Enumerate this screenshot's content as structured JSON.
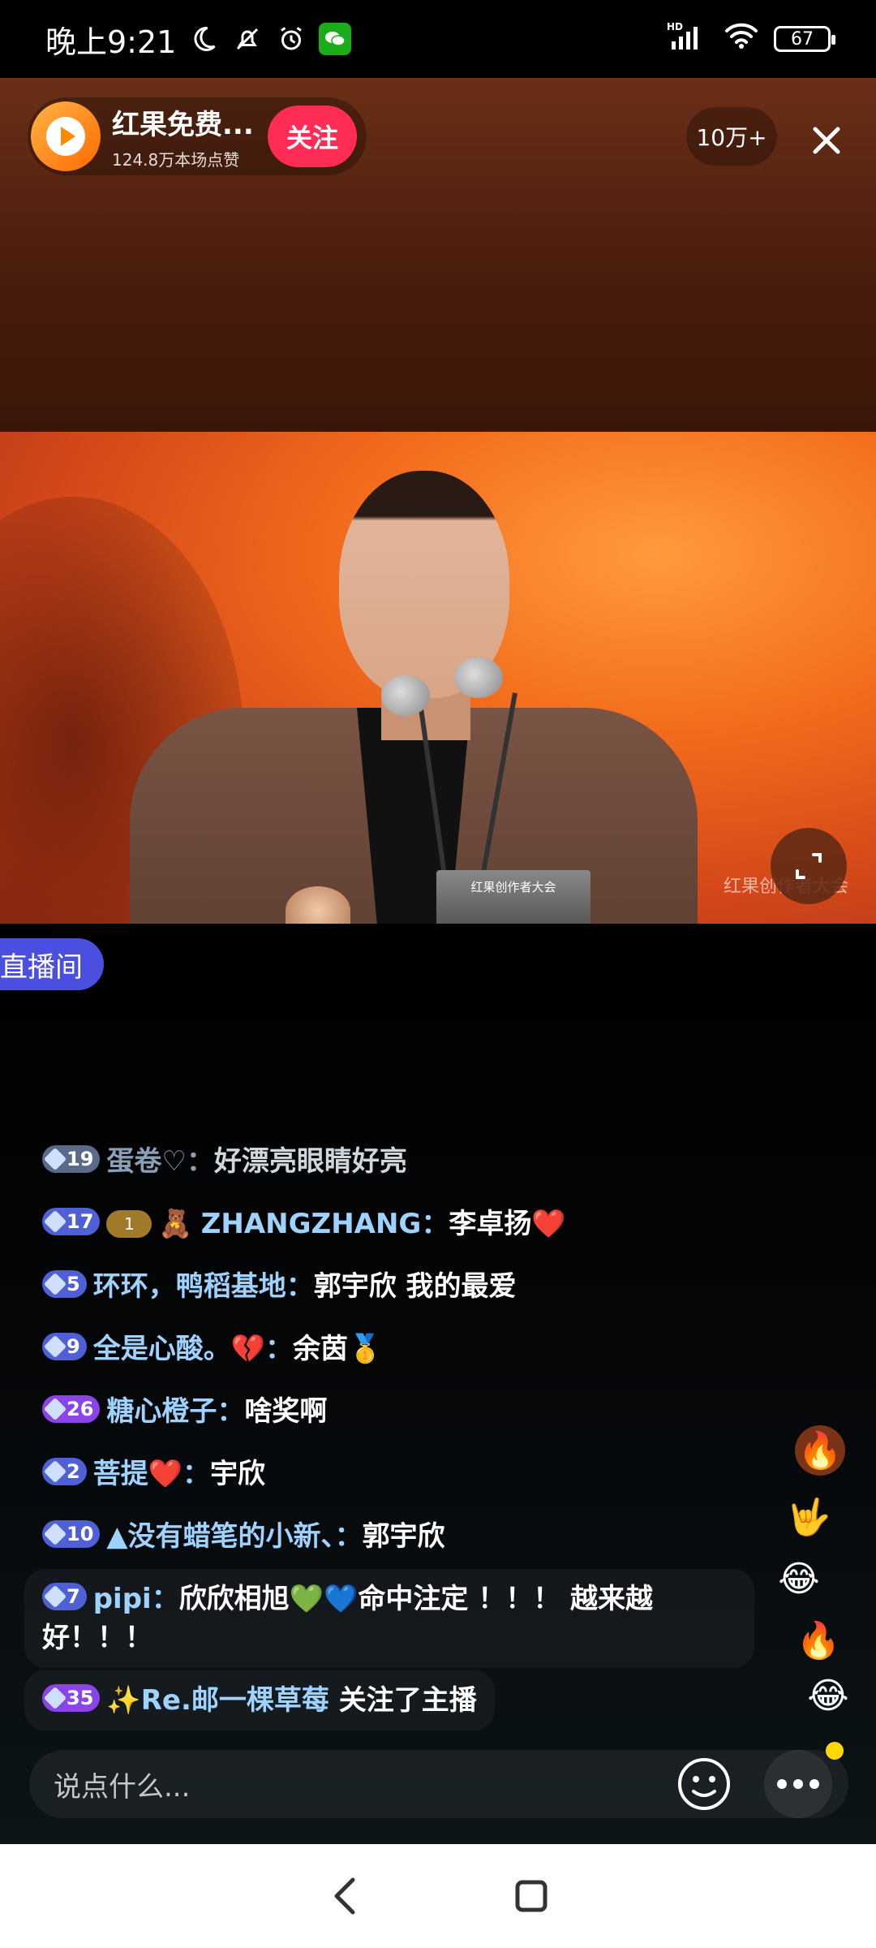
{
  "status_bar": {
    "time": "晚上9:21",
    "battery": "67",
    "network": "HD"
  },
  "header": {
    "host_name": "红果免费...",
    "host_likes": "124.8万本场点赞",
    "follow_label": "关注",
    "viewer_count": "10万+"
  },
  "video": {
    "podium_sign": "红果创作者大会",
    "watermark": "红果创作者大会"
  },
  "room_tag": "直播间",
  "chat": [
    {
      "level": "19",
      "badge_color": "gray",
      "user": "蛋卷♡",
      "text": "好漂亮眼睛好亮",
      "faded": true
    },
    {
      "level": "17",
      "badge_color": "blue",
      "extra_badge": "1",
      "user_prefix": "🧸",
      "user": "ZHANGZHANG",
      "text": "李卓扬❤️"
    },
    {
      "level": "5",
      "badge_color": "blue",
      "user": "环环，鸭稻基地",
      "text": "郭宇欣 我的最爱"
    },
    {
      "level": "9",
      "badge_color": "blue",
      "user": "全是心酸。💔",
      "text": "余茵🥇"
    },
    {
      "level": "26",
      "badge_color": "purple",
      "user": "糖心橙子",
      "text": "啥奖啊"
    },
    {
      "level": "2",
      "badge_color": "blue",
      "user": "菩提❤️",
      "text": "宇欣"
    },
    {
      "level": "10",
      "badge_color": "blue",
      "user": "▲没有蜡笔的小新、",
      "text": "郭宇欣"
    },
    {
      "level": "7",
      "badge_color": "blue",
      "user": "pipi",
      "text": "欣欣相旭💚💙命中注定 ！！！ 越来越好！！！"
    },
    {
      "level": "35",
      "badge_color": "purple",
      "user": "✨Re.邮一棵草莓",
      "text": "关注了主播",
      "system": true
    }
  ],
  "input": {
    "placeholder": "说点什么..."
  },
  "colors": {
    "follow": "#ff2d55",
    "room_tag": "#4a4fe0",
    "username": "#9fd3ff"
  },
  "icons": {
    "host_avatar": "play-logo-icon",
    "close": "close-icon",
    "fullscreen": "fullscreen-icon",
    "emoji": "smiley-icon",
    "more": "more-icon",
    "back": "back-icon",
    "home": "home-icon"
  }
}
